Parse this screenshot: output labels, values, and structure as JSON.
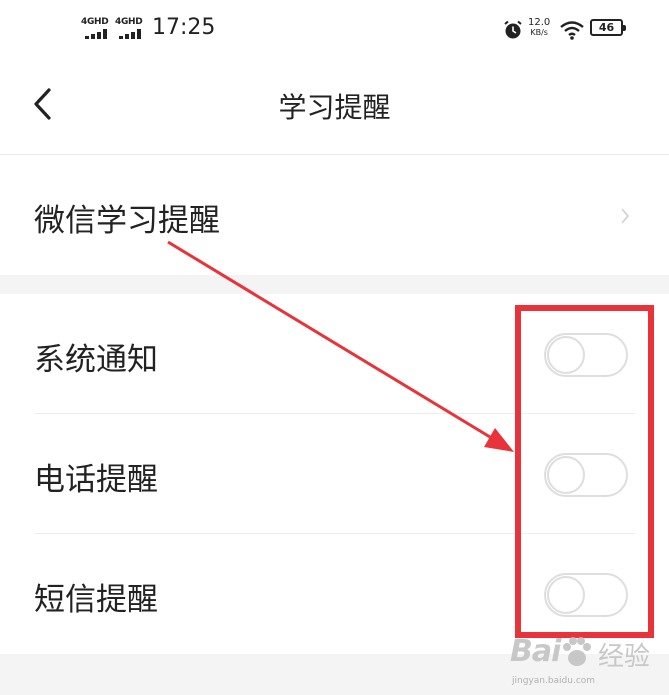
{
  "status_bar": {
    "signal_1": "4GHD",
    "signal_2": "4GHD",
    "time": "17:25",
    "net_speed_value": "12.0",
    "net_speed_unit": "KB/s",
    "battery": "46"
  },
  "nav": {
    "title": "学习提醒"
  },
  "wechat_row": {
    "label": "微信学习提醒"
  },
  "toggles": [
    {
      "label": "系统通知",
      "on": false
    },
    {
      "label": "电话提醒",
      "on": false
    },
    {
      "label": "短信提醒",
      "on": false
    }
  ],
  "watermark": {
    "brand_left": "Bai",
    "brand_right": "经验",
    "site": "jingyan.baidu.com"
  },
  "colors": {
    "annotation": "#e8333a",
    "toggle_border": "#dedede"
  }
}
